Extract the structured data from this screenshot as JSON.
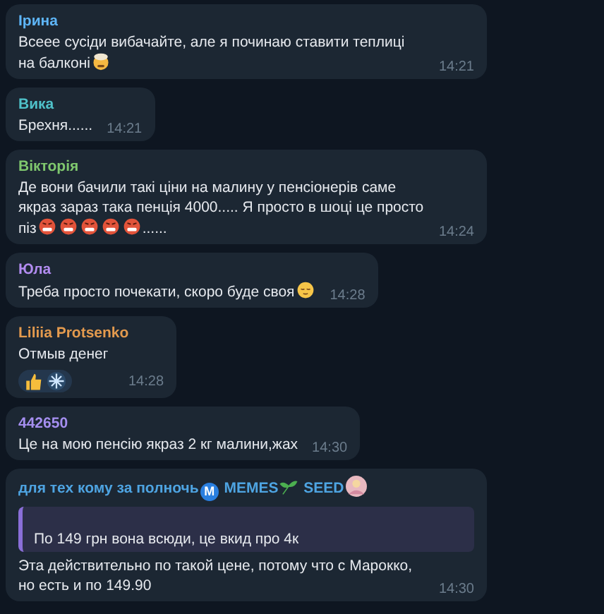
{
  "messages": [
    {
      "sender": [
        {
          "kind": "text",
          "text": "Ірина"
        }
      ],
      "color": "#5eb5f7",
      "body": [
        {
          "kind": "text",
          "text": "Всеее сусіди вибачайте, але я починаю ставити теплиці на балконі"
        },
        {
          "kind": "mind-blown"
        }
      ],
      "time": "14:21"
    },
    {
      "sender": [
        {
          "kind": "text",
          "text": "Вика"
        }
      ],
      "color": "#4fc1c9",
      "body": [
        {
          "kind": "text",
          "text": "Брехня......"
        }
      ],
      "time": "14:21"
    },
    {
      "sender": [
        {
          "kind": "text",
          "text": "Вікторія"
        }
      ],
      "color": "#7fc86e",
      "body": [
        {
          "kind": "text",
          "text": "Де вони бачили такі ціни на малину у пенсіонерів саме якраз зараз така пенція 4000..... Я просто в шоці це просто піз"
        },
        {
          "kind": "angry"
        },
        {
          "kind": "angry"
        },
        {
          "kind": "angry"
        },
        {
          "kind": "angry"
        },
        {
          "kind": "angry"
        },
        {
          "kind": "text",
          "text": "......"
        }
      ],
      "time": "14:24"
    },
    {
      "sender": [
        {
          "kind": "text",
          "text": "Юла"
        }
      ],
      "color": "#b28cf0",
      "body": [
        {
          "kind": "text",
          "text": "Треба просто почекати, скоро буде своя"
        },
        {
          "kind": "relieved"
        }
      ],
      "time": "14:28"
    },
    {
      "sender": [
        {
          "kind": "text",
          "text": "Liliia Protsenko"
        }
      ],
      "color": "#e39a4e",
      "body": [
        {
          "kind": "text",
          "text": "Отмыв денег"
        }
      ],
      "reactions": [
        {
          "kind": "thumbs-up"
        },
        {
          "kind": "burst"
        }
      ],
      "time": "14:28"
    },
    {
      "sender": [
        {
          "kind": "text",
          "text": "442650"
        }
      ],
      "color": "#a58ff0",
      "body": [
        {
          "kind": "text",
          "text": "Це на мою пенсію якраз 2 кг малини,жах"
        }
      ],
      "time": "14:30"
    },
    {
      "sender": [
        {
          "kind": "text",
          "text": "для тех кому за полночь"
        },
        {
          "kind": "badge",
          "text": "M"
        },
        {
          "kind": "text",
          "text": "MEMES"
        },
        {
          "kind": "sprout"
        },
        {
          "kind": "text",
          "text": "SEED"
        },
        {
          "kind": "avatar"
        }
      ],
      "color": "#4ea4e2",
      "quote": "По 149 грн вона всюди, це вкид про 4к",
      "body": [
        {
          "kind": "text",
          "text": "Эта действительно по такой цене, потому что с Марокко, но есть и по 149.90"
        }
      ],
      "time": "14:30"
    }
  ]
}
